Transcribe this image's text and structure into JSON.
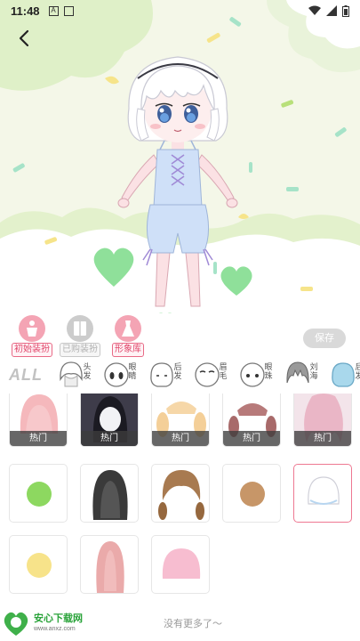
{
  "status_bar": {
    "time": "11:48",
    "icons": [
      "a-icon",
      "image-icon"
    ],
    "right_icons": [
      "wifi-icon",
      "signal-icon",
      "battery-icon"
    ]
  },
  "stage": {
    "back_icon": "chevron-left-icon",
    "colors": {
      "background": "#f4f7e8",
      "cloud_green": "#dff0c8",
      "heart": "#8fe09a"
    }
  },
  "actions": {
    "items": [
      {
        "label": "初始装扮",
        "icon": "mannequin-icon",
        "style": "pink"
      },
      {
        "label": "已购装扮",
        "icon": "wardrobe-icon",
        "style": "grey"
      },
      {
        "label": "形象库",
        "icon": "dress-icon",
        "style": "pink"
      }
    ],
    "save_label": "保存"
  },
  "tabs": {
    "all_label": "ALL",
    "items": [
      {
        "label": "头发",
        "icon": "hair-icon"
      },
      {
        "label": "眼睛",
        "icon": "eyes-icon"
      },
      {
        "label": "后发",
        "icon": "back-hair-icon"
      },
      {
        "label": "眉毛",
        "icon": "eyebrows-icon"
      },
      {
        "label": "眼珠",
        "icon": "pupils-icon"
      },
      {
        "label": "刘海",
        "icon": "bangs-icon"
      },
      {
        "label": "后发",
        "icon": "back-hair-icon"
      }
    ]
  },
  "grid": {
    "badge_text": "热门",
    "items": [
      {
        "kind": "pink-hair",
        "badge": true
      },
      {
        "kind": "dark-hair-photo",
        "badge": true
      },
      {
        "kind": "blonde-twintails",
        "badge": true
      },
      {
        "kind": "brown-twintails",
        "badge": true
      },
      {
        "kind": "pink-wavy-hair",
        "badge": true
      },
      {
        "kind": "green-color-swatch",
        "badge": false
      },
      {
        "kind": "long-black-hair",
        "badge": false
      },
      {
        "kind": "brown-braids",
        "badge": false
      },
      {
        "kind": "brown-color-swatch",
        "badge": false
      },
      {
        "kind": "white-bob-hair",
        "badge": false,
        "selected": true
      },
      {
        "kind": "yellow-color-swatch",
        "badge": false
      },
      {
        "kind": "long-pink-hair",
        "badge": false
      },
      {
        "kind": "pink-bob-hair",
        "badge": false
      }
    ]
  },
  "footer": {
    "no_more_text": "没有更多了～",
    "watermark": {
      "title": "安心下载网",
      "url": "www.anxz.com"
    }
  }
}
